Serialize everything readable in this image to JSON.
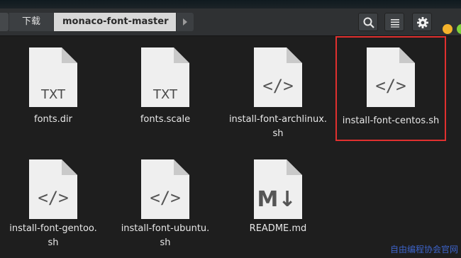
{
  "header": {
    "path": [
      {
        "label": "下载"
      },
      {
        "label": "monaco-font-master"
      }
    ],
    "buttons": {
      "search_icon": "search-icon",
      "view_icon": "list-view-icon",
      "settings_icon": "gear-icon"
    }
  },
  "files": [
    {
      "name_line1": "fonts.dir",
      "name_line2": "",
      "type_label": "TXT",
      "icon": "text-file-icon"
    },
    {
      "name_line1": "fonts.scale",
      "name_line2": "",
      "type_label": "TXT",
      "icon": "text-file-icon"
    },
    {
      "name_line1": "install-font-archlinux.",
      "name_line2": "sh",
      "type_label": "</>",
      "icon": "script-file-icon"
    },
    {
      "name_line1": "install-font-centos.sh",
      "name_line2": "",
      "type_label": "</>",
      "icon": "script-file-icon"
    },
    {
      "name_line1": "install-font-gentoo.",
      "name_line2": "sh",
      "type_label": "</>",
      "icon": "script-file-icon"
    },
    {
      "name_line1": "install-font-ubuntu.",
      "name_line2": "sh",
      "type_label": "</>",
      "icon": "script-file-icon"
    },
    {
      "name_line1": "README.md",
      "name_line2": "",
      "type_label": "M↓",
      "icon": "markdown-file-icon"
    }
  ],
  "watermark": "自由编程协会官网",
  "colors": {
    "highlight_border": "#e0302f",
    "minimize_dot": "#f4b32b",
    "maximize_dot": "#7fd13b",
    "watermark": "#3d63c9"
  }
}
